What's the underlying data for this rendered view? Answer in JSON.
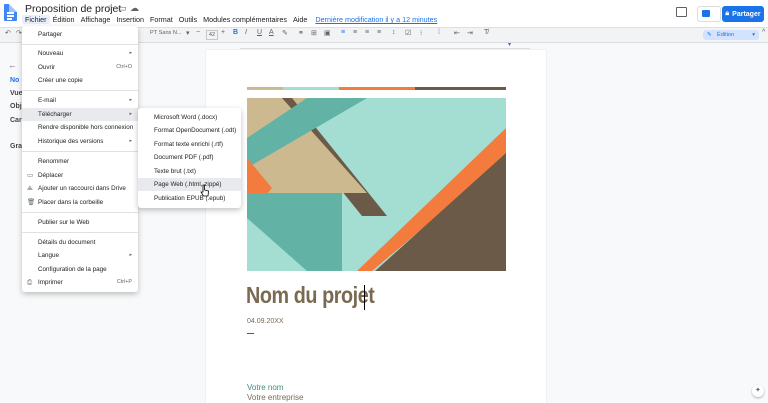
{
  "header": {
    "title": "Proposition de projet",
    "menus": [
      "Fichier",
      "Édition",
      "Affichage",
      "Insertion",
      "Format",
      "Outils",
      "Modules complémentaires",
      "Aide"
    ],
    "last_edit": "Dernière modification il y a 12 minutes",
    "share_label": "Partager"
  },
  "toolbar": {
    "font": "PT Sans N...",
    "size": "42",
    "mode": "Édition"
  },
  "outline": {
    "items": [
      "No",
      "Vue",
      "Obj",
      "Car",
      "Gra"
    ]
  },
  "file_menu": {
    "items": [
      {
        "label": "Partager"
      },
      {
        "label": "Nouveau",
        "arrow": "▸"
      },
      {
        "label": "Ouvrir",
        "shortcut": "Ctrl+O"
      },
      {
        "label": "Créer une copie"
      },
      {
        "label": "E-mail",
        "arrow": "▸"
      },
      {
        "label": "Télécharger",
        "arrow": "▸"
      },
      {
        "label": "Rendre disponible hors connexion"
      },
      {
        "label": "Historique des versions",
        "arrow": "▸"
      },
      {
        "label": "Renommer"
      },
      {
        "label": "Déplacer"
      },
      {
        "label": "Ajouter un raccourci dans Drive"
      },
      {
        "label": "Placer dans la corbeille"
      },
      {
        "label": "Publier sur le Web"
      },
      {
        "label": "Détails du document"
      },
      {
        "label": "Langue",
        "arrow": "▸"
      },
      {
        "label": "Configuration de la page"
      },
      {
        "label": "Imprimer",
        "shortcut": "Ctrl+P"
      }
    ]
  },
  "download_menu": {
    "items": [
      {
        "label": "Microsoft Word (.docx)"
      },
      {
        "label": "Format OpenDocument (.odt)"
      },
      {
        "label": "Format texte enrichi (.rtf)"
      },
      {
        "label": "Document PDF (.pdf)"
      },
      {
        "label": "Texte brut (.txt)"
      },
      {
        "label": "Page Web (.html, zippé)"
      },
      {
        "label": "Publication EPUB (.epub)"
      }
    ]
  },
  "document": {
    "title": "Nom du projet",
    "date": "04.09.20XX",
    "name": "Votre nom",
    "company": "Votre entreprise"
  },
  "colors": {
    "accent": "#1a73e8",
    "title_brown": "#7a6a52",
    "teal": "#a4ddd1",
    "orange": "#f47b3e",
    "dark_brown": "#6b5a48",
    "tan": "#cdb98f"
  }
}
